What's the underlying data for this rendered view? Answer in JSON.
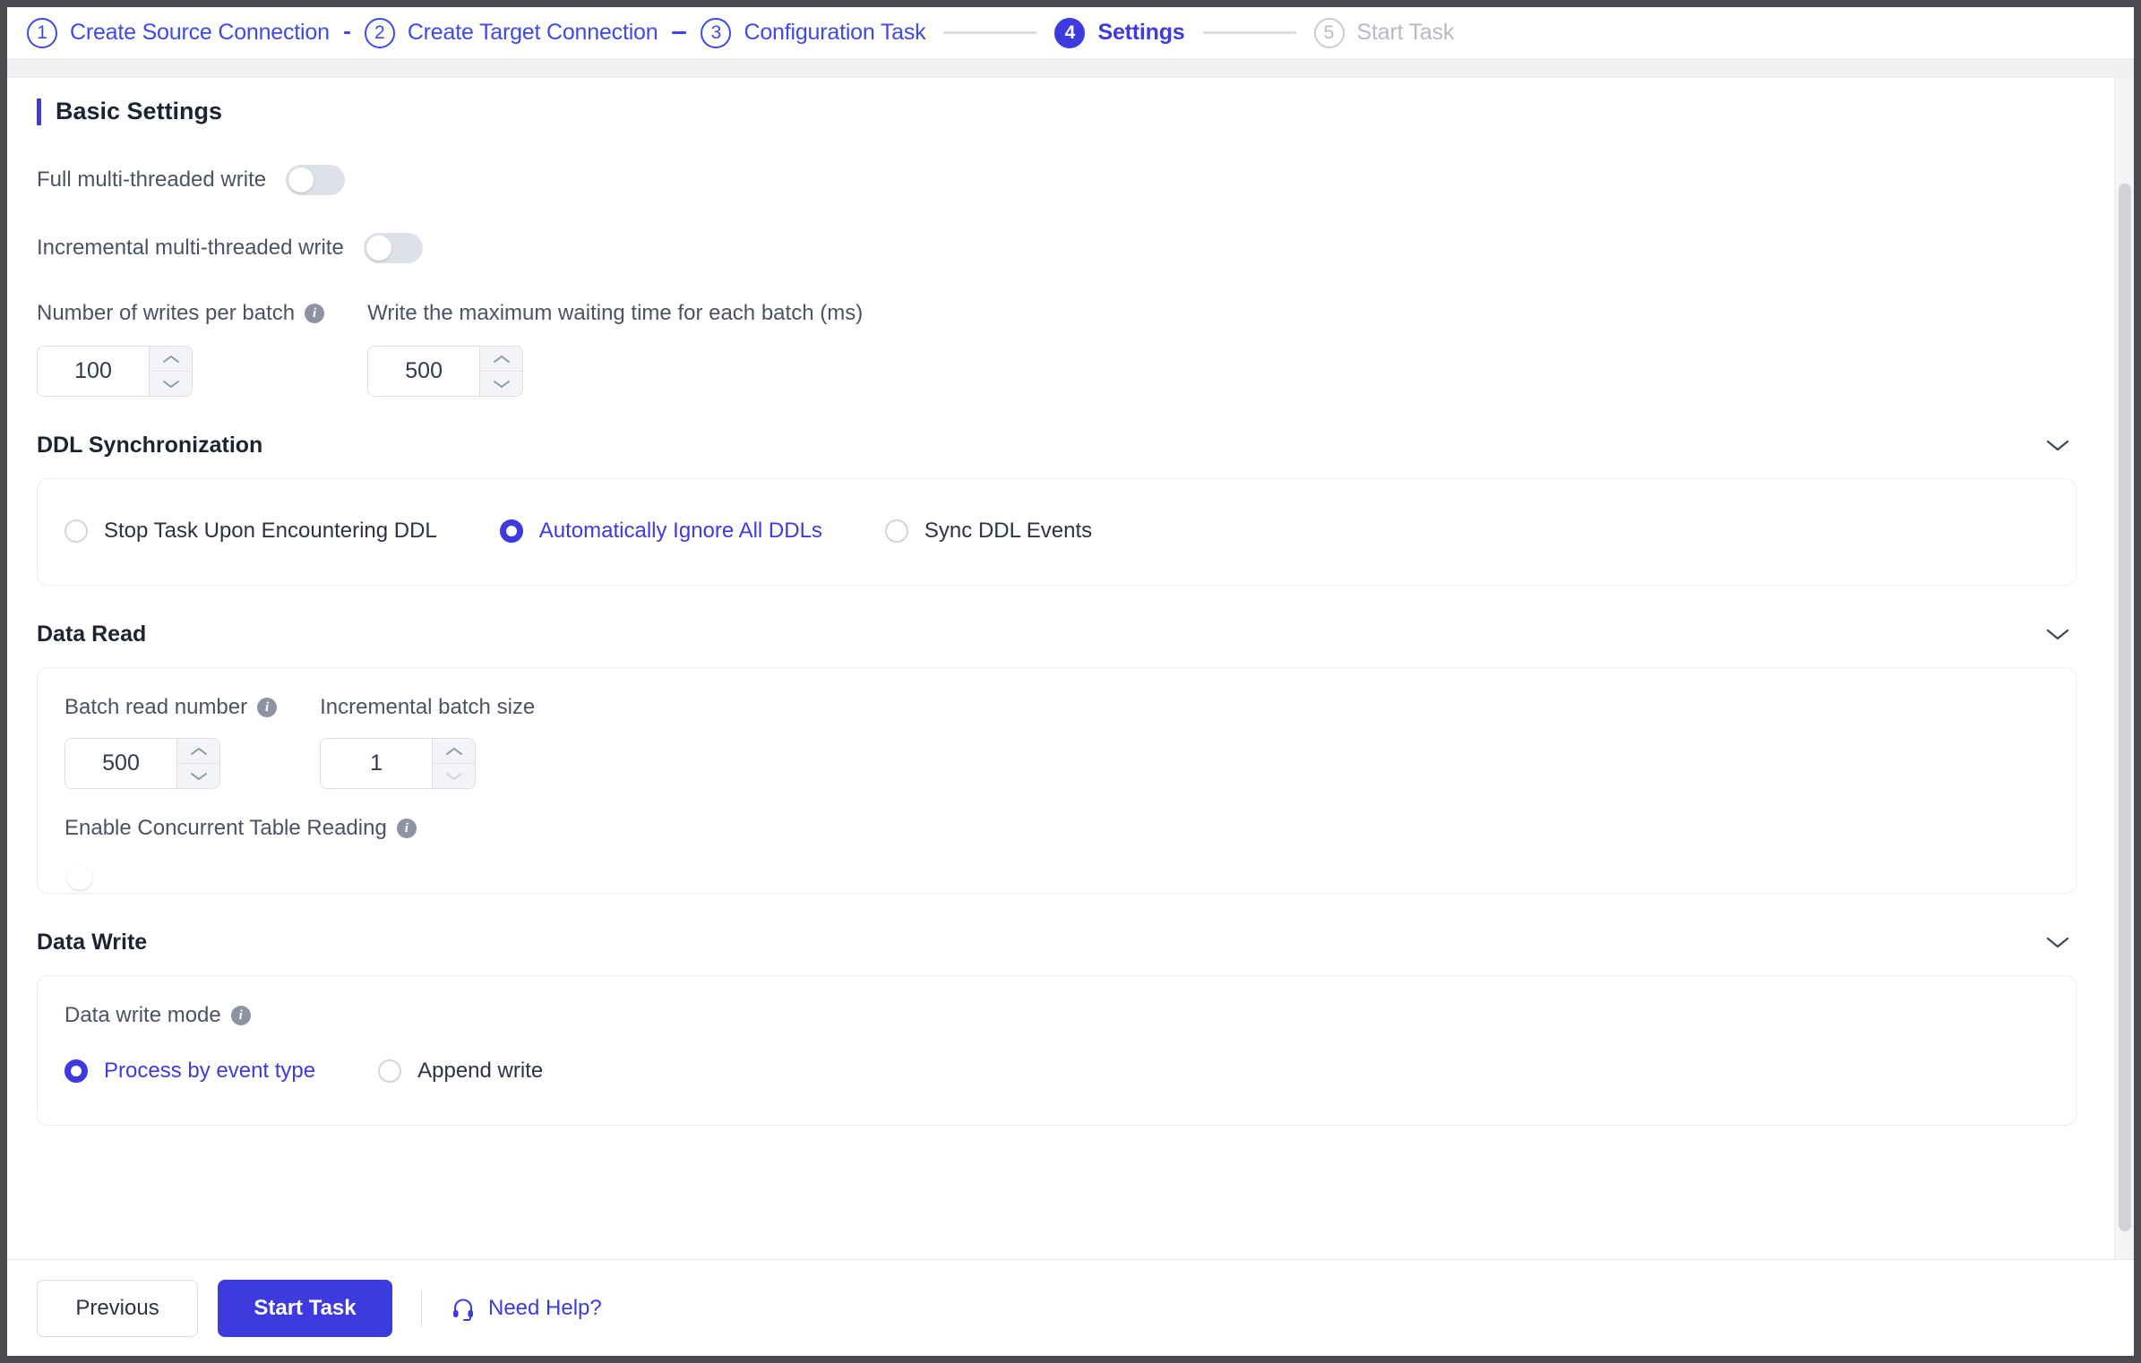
{
  "stepper": {
    "steps": [
      {
        "number": "1",
        "label": "Create Source Connection",
        "state": "done"
      },
      {
        "number": "2",
        "label": "Create Target Connection",
        "state": "done"
      },
      {
        "number": "3",
        "label": "Configuration Task",
        "state": "done"
      },
      {
        "number": "4",
        "label": "Settings",
        "state": "active"
      },
      {
        "number": "5",
        "label": "Start Task",
        "state": "inactive"
      }
    ]
  },
  "basic": {
    "title": "Basic Settings",
    "full_multithread_label": "Full multi-threaded write",
    "full_multithread_value": "off",
    "incremental_multithread_label": "Incremental multi-threaded write",
    "incremental_multithread_value": "off",
    "writes_per_batch_label": "Number of writes per batch",
    "writes_per_batch_value": "100",
    "max_wait_label": "Write the maximum waiting time for each batch (ms)",
    "max_wait_value": "500"
  },
  "ddl": {
    "title": "DDL Synchronization",
    "options": [
      {
        "label": "Stop Task Upon Encountering DDL",
        "checked": false
      },
      {
        "label": "Automatically Ignore All DDLs",
        "checked": true
      },
      {
        "label": "Sync DDL Events",
        "checked": false
      }
    ]
  },
  "data_read": {
    "title": "Data Read",
    "batch_read_label": "Batch read number",
    "batch_read_value": "500",
    "incremental_batch_label": "Incremental batch size",
    "incremental_batch_value": "1",
    "concurrent_label": "Enable Concurrent Table Reading",
    "concurrent_value": "off"
  },
  "data_write": {
    "title": "Data Write",
    "mode_label": "Data write mode",
    "options": [
      {
        "label": "Process by event type",
        "checked": true
      },
      {
        "label": "Append write",
        "checked": false
      }
    ]
  },
  "footer": {
    "previous_label": "Previous",
    "start_task_label": "Start Task",
    "help_label": "Need Help?"
  },
  "colors": {
    "accent": "#3d3ae0",
    "step_blue": "#3d4ae5",
    "text_dark": "#1c2333",
    "text_muted": "#4b5264",
    "toggle_off": "#dfe1e8"
  }
}
